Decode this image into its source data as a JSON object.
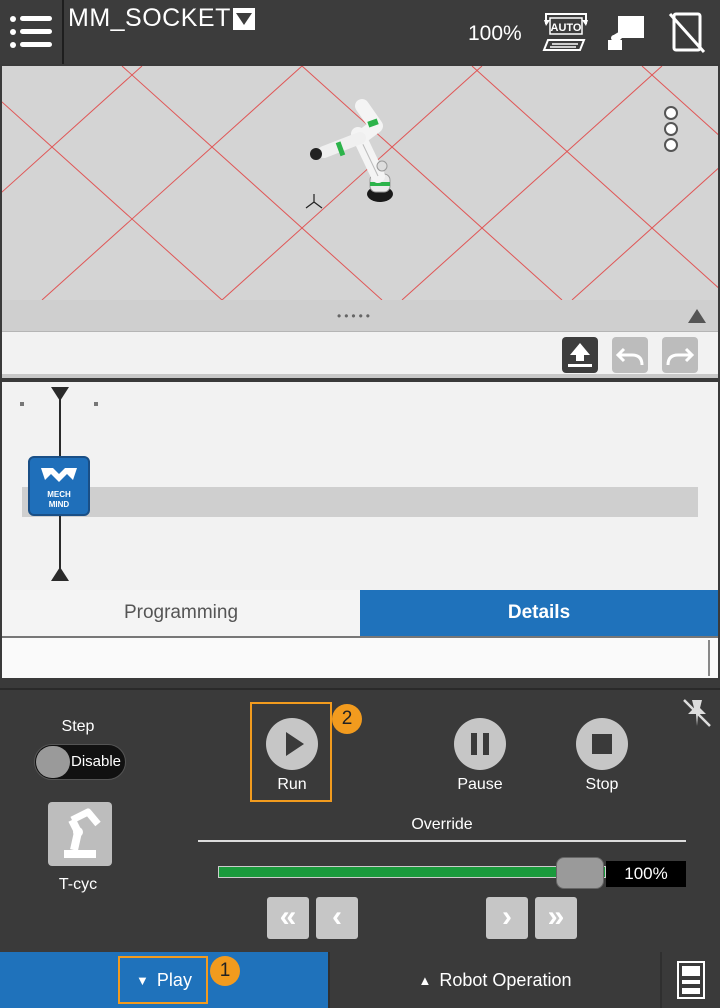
{
  "header": {
    "program_name": "MM_SOCKET",
    "speed": "100%",
    "auto_label": "AUTO"
  },
  "view": {
    "menu_icon": "vertical-dots-icon"
  },
  "tabs": [
    {
      "label": "Programming",
      "active": false
    },
    {
      "label": "Details",
      "active": true
    }
  ],
  "tree": {
    "node_label_line1": "MECH",
    "node_label_line2": "MIND"
  },
  "play_panel": {
    "step_label": "Step",
    "step_toggle": "Disable",
    "tcyc_label": "T-cyc",
    "run_label": "Run",
    "pause_label": "Pause",
    "stop_label": "Stop",
    "override_label": "Override",
    "override_value": "100%",
    "override_fraction": 1.0
  },
  "callouts": {
    "run_badge": "2",
    "play_badge": "1"
  },
  "bottom": {
    "play_tab": "Play",
    "robot_tab": "Robot Operation"
  },
  "colors": {
    "accent_blue": "#1f72bb",
    "highlight_orange": "#f29b1e",
    "override_green": "#1a9a3c"
  }
}
